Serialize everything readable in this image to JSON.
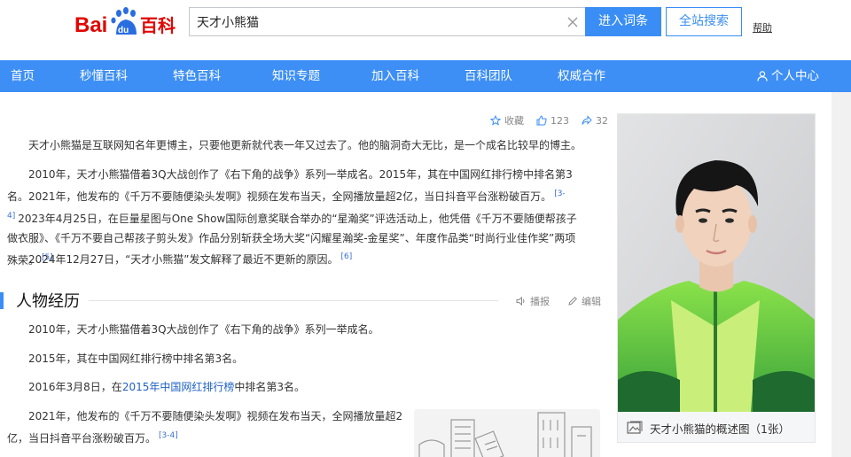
{
  "header": {
    "logo_text_bai": "Bai",
    "logo_text_du": "du",
    "logo_text_baike": "百科",
    "search_value": "天才小熊猫",
    "enter_label": "进入词条",
    "site_search_label": "全站搜索",
    "help_label": "帮助"
  },
  "nav": {
    "items": [
      "首页",
      "秒懂百科",
      "特色百科",
      "知识专题",
      "加入百科",
      "百科团队",
      "权威合作"
    ],
    "user_center": "个人中心"
  },
  "actions": {
    "collect": "收藏",
    "likes": "123",
    "shares": "32"
  },
  "intro": {
    "p1": "天才小熊猫是互联网知名年更博主，只要他更新就代表一年又过去了。他的脑洞奇大无比，是一个成名比较早的博主。",
    "p2_a": "2010年，天才小熊猫借着3Q大战创作了《右下角的战争》系列一举成名。2015年，其在中国网红排行榜中排名第3名。2021年，他发布的《千万不要随便染头发啊》视频在发布当天，全网播放量超2亿，当日抖音平台涨粉破百万。",
    "p2_ref1": "[3-4]",
    "p2_b": "2023年4月25日，在巨量星图与One Show国际创意奖联合举办的“星瀚奖”评选活动上，他凭借《千万不要随便帮孩子做衣服》、《千万不要自己帮孩子剪头发》作品分别斩获全场大奖“闪耀星瀚奖-金星奖”、年度作品类“时尚行业佳作奖”两项殊荣。",
    "p2_ref2": "[5]",
    "p3": "2024年12月27日，“天才小熊猫”发文解释了最近不更新的原因。",
    "p3_ref": "[6]"
  },
  "section": {
    "title": "人物经历",
    "broadcast": "播报",
    "edit": "编辑"
  },
  "career": {
    "l1": "2010年，天才小熊猫借着3Q大战创作了《右下角的战争》系列一举成名。",
    "l2": "2015年，其在中国网红排行榜中排名第3名。",
    "l3_a": "2016年3月8日，在",
    "l3_link": "2015年中国网红排行榜",
    "l3_b": "中排名第3名。",
    "l4": "2021年，他发布的《千万不要随便染头发啊》视频在发布当天，全网播放量超2亿，当日抖音平台涨粉破百万。",
    "l4_ref": "[3-4]"
  },
  "photo": {
    "caption": "天才小熊猫的概述图（1张）"
  },
  "colors": {
    "brand_red": "#e10602",
    "brand_blue": "#2a6de0",
    "nav_blue": "#3d8ff6",
    "link_blue": "#1f61c6"
  }
}
